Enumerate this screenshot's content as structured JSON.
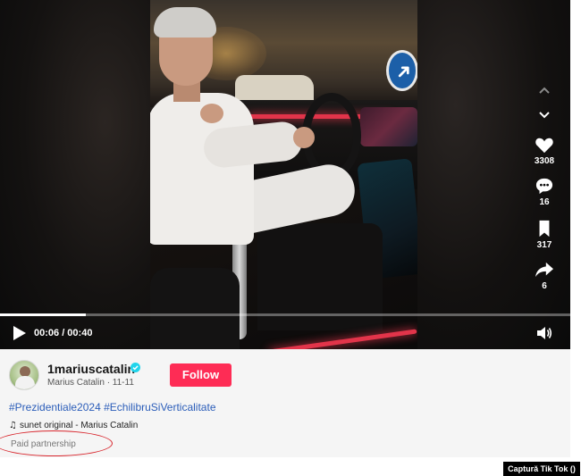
{
  "player": {
    "time_display": "00:06 / 00:40",
    "progress_fraction": 0.15
  },
  "actions": {
    "likes": "3308",
    "comments": "16",
    "saves": "317",
    "shares": "6"
  },
  "author": {
    "username": "1mariuscatalin",
    "display_line": "Marius Catalin · 11-11",
    "verified": true
  },
  "follow_label": "Follow",
  "hashtags": [
    "#Prezidentiale2024",
    "#EchilibruSiVerticalitate"
  ],
  "music": "sunet original - Marius Catalin",
  "paid_label": "Paid partnership",
  "credit": "Captură Tik Tok ()",
  "colors": {
    "follow_bg": "#fe2c55",
    "hashtag": "#2b5db9",
    "highlight_oval": "#d8262d"
  },
  "icons": [
    "play-icon",
    "volume-icon",
    "chevron-up-icon",
    "chevron-down-icon",
    "heart-icon",
    "comment-icon",
    "bookmark-icon",
    "share-icon",
    "verified-badge-icon",
    "music-note-icon"
  ]
}
